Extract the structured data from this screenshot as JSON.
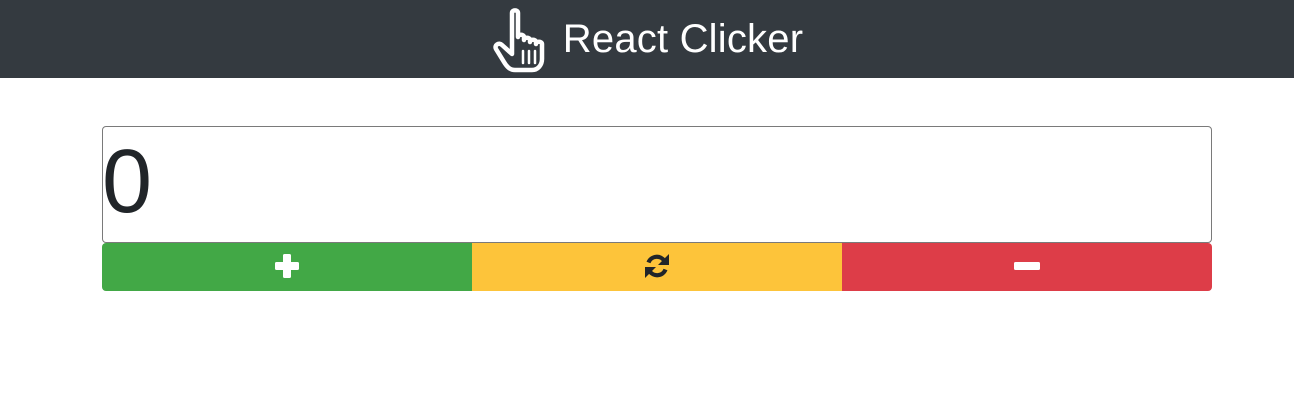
{
  "navbar": {
    "brand_icon": "pointing-hand-icon",
    "title": "React Clicker",
    "background": "#343a40"
  },
  "counter": {
    "value": "0"
  },
  "controls": {
    "increment_icon": "plus-icon",
    "reset_icon": "refresh-icon",
    "decrement_icon": "minus-icon",
    "colors": {
      "increment": "#42a846",
      "reset": "#fdc43a",
      "decrement": "#dd3d48"
    }
  }
}
